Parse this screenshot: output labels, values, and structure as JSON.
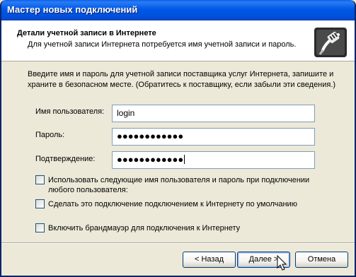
{
  "window": {
    "title": "Мастер новых подключений"
  },
  "header": {
    "title": "Детали учетной записи в Интернете",
    "subtitle": "Для учетной записи Интернета потребуется имя учетной записи и пароль.",
    "icon": "network-cable-icon"
  },
  "intro": "Введите имя и пароль для учетной записи поставщика услуг Интернета, запишите и храните в безопасном месте. (Обратитесь к поставщику, если забыли эти сведения.)",
  "fields": {
    "username": {
      "label": "Имя пользователя:",
      "value": "login"
    },
    "password": {
      "label": "Пароль:",
      "value": "●●●●●●●●●●●●"
    },
    "confirm": {
      "label": "Подтверждение:",
      "value": "●●●●●●●●●●●●"
    }
  },
  "options": [
    {
      "label_line1": "Использовать следующие имя пользователя и пароль при подключении",
      "label_line2": "любого пользователя:",
      "checked": false
    },
    {
      "label_line1": "Сделать это подключение подключением к Интернету по умолчанию",
      "checked": false
    },
    {
      "label_line1": "Включить брандмауэр для подключения к Интернету",
      "checked": false
    }
  ],
  "buttons": {
    "back": "< Назад",
    "next": "Далее >",
    "cancel": "Отмена"
  },
  "colors": {
    "titlebar": "#0058E6",
    "dialog": "#ECE9D8",
    "field_border": "#7F9DB9"
  }
}
